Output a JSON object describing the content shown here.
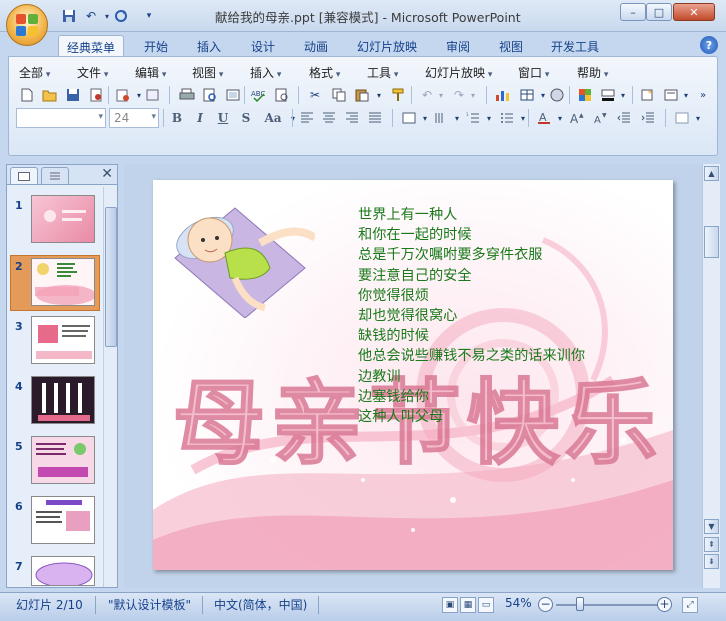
{
  "window": {
    "title": "献给我的母亲.ppt [兼容模式] - Microsoft PowerPoint",
    "minimize": "–",
    "maximize": "□",
    "close": "✕"
  },
  "ribbon_tabs": [
    "经典菜单",
    "开始",
    "插入",
    "设计",
    "动画",
    "幻灯片放映",
    "审阅",
    "视图",
    "开发工具"
  ],
  "help": "?",
  "classic_menus": [
    "全部",
    "文件",
    "编辑",
    "视图",
    "插入",
    "格式",
    "工具",
    "幻灯片放映",
    "窗口",
    "帮助"
  ],
  "font_name_value": "",
  "font_size_value": "24",
  "format_buttons": [
    "B",
    "I",
    "U",
    "S",
    "Aa"
  ],
  "slide_thumbnails": [
    "1",
    "2",
    "3",
    "4",
    "5",
    "6",
    "7"
  ],
  "slide": {
    "poem_lines": [
      "世界上有一种人",
      "和你在一起的时候",
      "总是千万次嘱咐要多穿件衣服",
      "要注意自己的安全",
      "你觉得很烦",
      "却也觉得很窝心",
      "缺钱的时候",
      "他总会说些赚钱不易之类的话来训你",
      "边教训",
      "边塞钱给你",
      "这种人叫父母"
    ],
    "art_title": "母亲节快乐"
  },
  "status": {
    "slide_info": "幻灯片 2/10",
    "template": "\"默认设计模板\"",
    "language": "中文(简体，中国)",
    "zoom": "54%"
  },
  "colors": {
    "poem_text": "#1a7a1a",
    "ribbon_blue": "#15428b",
    "selected_thumb": "#e49b5a"
  }
}
